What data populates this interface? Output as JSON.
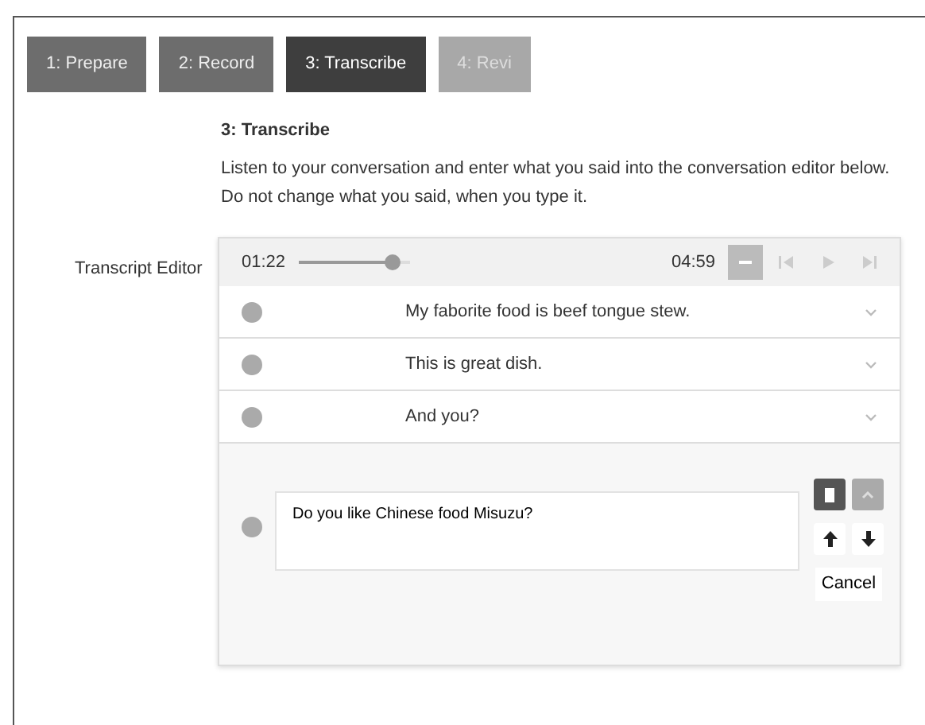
{
  "steps": [
    {
      "label": "1: Prepare",
      "selected": false,
      "disabled": false
    },
    {
      "label": "2: Record",
      "selected": false,
      "disabled": false
    },
    {
      "label": "3: Transcribe",
      "selected": true,
      "disabled": false
    },
    {
      "label": "4: Revi",
      "selected": false,
      "disabled": true
    }
  ],
  "heading": "3: Transcribe",
  "instructions": "Listen to your conversation and enter what you said into the conversation editor below. Do not change what you said, when you type it.",
  "editor_label": "Transcript Editor",
  "player": {
    "current_time": "01:22",
    "total_time": "04:59"
  },
  "lines": [
    {
      "text": "My faborite food is beef tongue stew."
    },
    {
      "text": "This is great dish."
    },
    {
      "text": "And you?"
    }
  ],
  "editing": {
    "value": "Do you like Chinese food Misuzu?",
    "cancel": "Cancel"
  }
}
